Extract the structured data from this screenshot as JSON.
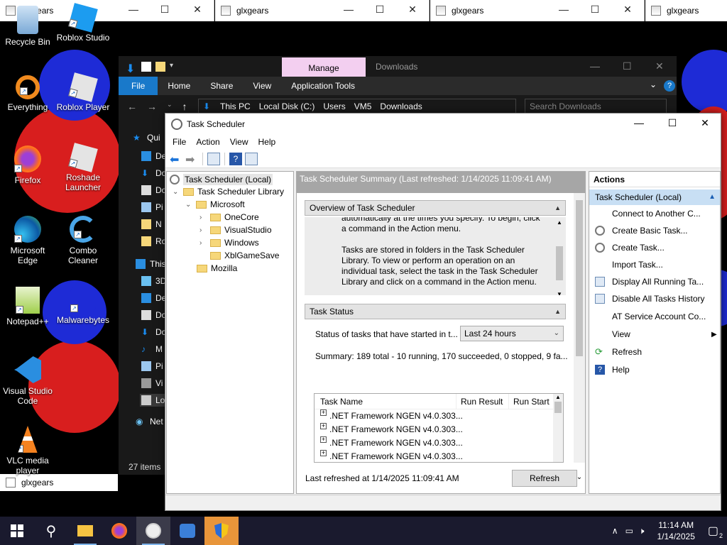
{
  "glx": {
    "title": "glxgears",
    "bottom_title": "glxgears"
  },
  "desktop": {
    "icons": [
      {
        "label": "Recycle Bin"
      },
      {
        "label": "Roblox Studio"
      },
      {
        "label": "Everything"
      },
      {
        "label": "Roblox Player"
      },
      {
        "label": "Firefox"
      },
      {
        "label": "Roshade Launcher"
      },
      {
        "label": "Microsoft Edge"
      },
      {
        "label": "Combo Cleaner"
      },
      {
        "label": "Notepad++"
      },
      {
        "label": "Malwarebytes"
      },
      {
        "label": "Visual Studio Code"
      },
      {
        "label": "VLC media player"
      }
    ]
  },
  "explorer": {
    "manage_tab": "Manage",
    "title": "Downloads",
    "ribbon": {
      "file": "File",
      "tabs": [
        "Home",
        "Share",
        "View",
        "Application Tools"
      ]
    },
    "path": [
      "This PC",
      "Local Disk (C:)",
      "Users",
      "VM5",
      "Downloads"
    ],
    "search_placeholder": "Search Downloads",
    "nav_items": [
      "Qui",
      "De",
      "Do",
      "Do",
      "Pi",
      "N",
      "Ro",
      "This",
      "3D",
      "De",
      "Do",
      "Do",
      "M",
      "Pi",
      "Vi",
      "Lo",
      "Net"
    ],
    "status": "27 items"
  },
  "scheduler": {
    "title": "Task Scheduler",
    "menu": [
      "File",
      "Action",
      "View",
      "Help"
    ],
    "tree": {
      "root": "Task Scheduler (Local)",
      "library": "Task Scheduler Library",
      "microsoft": "Microsoft",
      "children": [
        "OneCore",
        "VisualStudio",
        "Windows",
        "XblGameSave"
      ],
      "mozilla": "Mozilla"
    },
    "summary_header": "Task Scheduler Summary (Last refreshed: 1/14/2025 11:09:41 AM)",
    "overview": {
      "heading": "Overview of Task Scheduler",
      "lines": [
        "automatically at the times you specify. To begin, click",
        "a command in the Action menu.",
        "",
        "Tasks are stored in folders in the Task Scheduler",
        "Library. To view or perform an operation on an",
        "individual task, select the task in the Task Scheduler",
        "Library and click on a command in the Action menu."
      ]
    },
    "task_status": {
      "heading": "Task Status",
      "status_label": "Status of tasks that have started in t...",
      "range_selected": "Last 24 hours",
      "summary": "Summary: 189 total - 10 running, 170 succeeded, 0 stopped, 9 fa...",
      "columns": [
        "Task Name",
        "Run Result",
        "Run Start"
      ],
      "rows": [
        ".NET Framework NGEN v4.0.303...",
        ".NET Framework NGEN v4.0.303...",
        ".NET Framework NGEN v4.0.303...",
        ".NET Framework NGEN v4.0.303..."
      ]
    },
    "last_refreshed": "Last refreshed at 1/14/2025 11:09:41 AM",
    "refresh_button": "Refresh",
    "actions": {
      "heading": "Actions",
      "group": "Task Scheduler (Local)",
      "items": [
        "Connect to Another C...",
        "Create Basic Task...",
        "Create Task...",
        "Import Task...",
        "Display All Running Ta...",
        "Disable All Tasks History",
        "AT Service Account Co...",
        "View",
        "Refresh",
        "Help"
      ]
    }
  },
  "taskbar": {
    "time": "11:14 AM",
    "date": "1/14/2025",
    "notification_count": "2"
  }
}
